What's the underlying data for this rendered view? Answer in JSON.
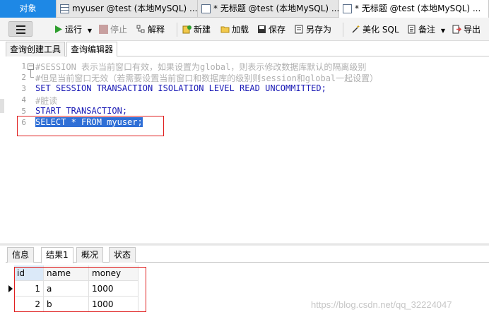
{
  "tabs": {
    "objects": "对象",
    "t1": "myuser @test (本地MySQL) ...",
    "t2": "* 无标题 @test (本地MySQL) ...",
    "t3": "* 无标题 @test (本地MySQL) ..."
  },
  "toolbar": {
    "run": "运行",
    "stop": "停止",
    "explain": "解释",
    "new": "新建",
    "load": "加载",
    "save": "保存",
    "save_as": "另存为",
    "beautify": "美化 SQL",
    "notes": "备注",
    "export": "导出"
  },
  "subtabs": [
    "查询创建工具",
    "查询编辑器"
  ],
  "editor": {
    "line_numbers": [
      "1",
      "2",
      "3",
      "4",
      "5",
      "6"
    ],
    "lines": [
      "#SESSION 表示当前窗口有效，如果设置为global，则表示修改数据库默认的隔离级别",
      "#但是当前窗口无效（若需要设置当前窗口和数据库的级别则session和global一起设置）",
      "SET SESSION TRANSACTION ISOLATION LEVEL READ UNCOMMITTED;",
      "#脏读",
      "START TRANSACTION;",
      "SELECT * FROM myuser;"
    ]
  },
  "result_tabs": [
    "信息",
    "结果1",
    "概况",
    "状态"
  ],
  "result_grid": {
    "columns": [
      "id",
      "name",
      "money"
    ],
    "rows": [
      [
        "1",
        "a",
        "1000"
      ],
      [
        "2",
        "b",
        "1000"
      ]
    ]
  },
  "watermark": "https://blog.csdn.net/qq_32224047",
  "colors": {
    "accent": "#1e88e5",
    "keyword": "#1a1ab5",
    "comment": "#b0b0b0",
    "selection": "#2f6fd6",
    "highlight_box": "#e02020"
  }
}
